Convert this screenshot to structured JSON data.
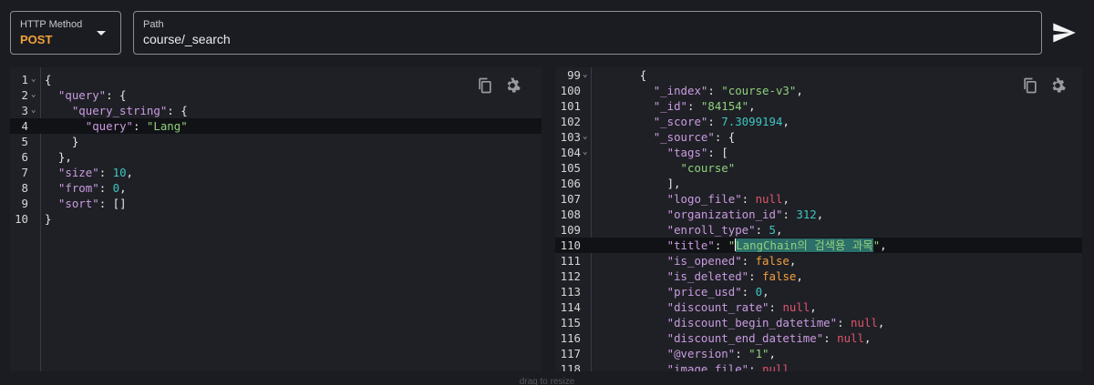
{
  "request": {
    "method_label": "HTTP Method",
    "method_value": "POST",
    "path_label": "Path",
    "path_value": "course/_search"
  },
  "query_editor": {
    "lines": [
      {
        "n": "1",
        "fold": true,
        "tokens": [
          [
            "p",
            "{"
          ]
        ]
      },
      {
        "n": "2",
        "fold": true,
        "tokens": [
          [
            "p",
            "  "
          ],
          [
            "k",
            "\"query\""
          ],
          [
            "p",
            ": {"
          ]
        ]
      },
      {
        "n": "3",
        "fold": true,
        "tokens": [
          [
            "p",
            "    "
          ],
          [
            "k",
            "\"query_string\""
          ],
          [
            "p",
            ": {"
          ]
        ]
      },
      {
        "n": "4",
        "fold": false,
        "active": true,
        "tokens": [
          [
            "p",
            "      "
          ],
          [
            "k",
            "\"query\""
          ],
          [
            "p",
            ": "
          ],
          [
            "s",
            "\"Lang\""
          ]
        ]
      },
      {
        "n": "5",
        "fold": false,
        "tokens": [
          [
            "p",
            "    }"
          ]
        ]
      },
      {
        "n": "6",
        "fold": false,
        "tokens": [
          [
            "p",
            "  },"
          ]
        ]
      },
      {
        "n": "7",
        "fold": false,
        "tokens": [
          [
            "p",
            "  "
          ],
          [
            "k",
            "\"size\""
          ],
          [
            "p",
            ": "
          ],
          [
            "n",
            "10"
          ],
          [
            "p",
            ","
          ]
        ]
      },
      {
        "n": "8",
        "fold": false,
        "tokens": [
          [
            "p",
            "  "
          ],
          [
            "k",
            "\"from\""
          ],
          [
            "p",
            ": "
          ],
          [
            "n",
            "0"
          ],
          [
            "p",
            ","
          ]
        ]
      },
      {
        "n": "9",
        "fold": false,
        "tokens": [
          [
            "p",
            "  "
          ],
          [
            "k",
            "\"sort\""
          ],
          [
            "p",
            ": []"
          ]
        ]
      },
      {
        "n": "10",
        "fold": false,
        "tokens": [
          [
            "p",
            "}"
          ]
        ]
      }
    ]
  },
  "response_viewer": {
    "lines": [
      {
        "n": "99",
        "fold": true,
        "tokens": [
          [
            "p",
            "      {"
          ]
        ]
      },
      {
        "n": "100",
        "fold": false,
        "tokens": [
          [
            "p",
            "        "
          ],
          [
            "k",
            "\"_index\""
          ],
          [
            "p",
            ": "
          ],
          [
            "s",
            "\"course-v3\""
          ],
          [
            "p",
            ","
          ]
        ]
      },
      {
        "n": "101",
        "fold": false,
        "tokens": [
          [
            "p",
            "        "
          ],
          [
            "k",
            "\"_id\""
          ],
          [
            "p",
            ": "
          ],
          [
            "s",
            "\"84154\""
          ],
          [
            "p",
            ","
          ]
        ]
      },
      {
        "n": "102",
        "fold": false,
        "tokens": [
          [
            "p",
            "        "
          ],
          [
            "k",
            "\"_score\""
          ],
          [
            "p",
            ": "
          ],
          [
            "n",
            "7.3099194"
          ],
          [
            "p",
            ","
          ]
        ]
      },
      {
        "n": "103",
        "fold": true,
        "tokens": [
          [
            "p",
            "        "
          ],
          [
            "k",
            "\"_source\""
          ],
          [
            "p",
            ": {"
          ]
        ]
      },
      {
        "n": "104",
        "fold": true,
        "tokens": [
          [
            "p",
            "          "
          ],
          [
            "k",
            "\"tags\""
          ],
          [
            "p",
            ": ["
          ]
        ]
      },
      {
        "n": "105",
        "fold": false,
        "tokens": [
          [
            "p",
            "            "
          ],
          [
            "s",
            "\"course\""
          ]
        ]
      },
      {
        "n": "106",
        "fold": false,
        "tokens": [
          [
            "p",
            "          ],"
          ]
        ]
      },
      {
        "n": "107",
        "fold": false,
        "tokens": [
          [
            "p",
            "          "
          ],
          [
            "k",
            "\"logo_file\""
          ],
          [
            "p",
            ": "
          ],
          [
            "x",
            "null"
          ],
          [
            "p",
            ","
          ]
        ]
      },
      {
        "n": "108",
        "fold": false,
        "tokens": [
          [
            "p",
            "          "
          ],
          [
            "k",
            "\"organization_id\""
          ],
          [
            "p",
            ": "
          ],
          [
            "n",
            "312"
          ],
          [
            "p",
            ","
          ]
        ]
      },
      {
        "n": "109",
        "fold": false,
        "tokens": [
          [
            "p",
            "          "
          ],
          [
            "k",
            "\"enroll_type\""
          ],
          [
            "p",
            ": "
          ],
          [
            "n",
            "5"
          ],
          [
            "p",
            ","
          ]
        ]
      },
      {
        "n": "110",
        "fold": false,
        "active": true,
        "tokens": [
          [
            "p",
            "          "
          ],
          [
            "k",
            "\"title\""
          ],
          [
            "p",
            ": "
          ],
          [
            "s",
            "\""
          ],
          [
            "c",
            ""
          ],
          [
            "h",
            "LangChain의 검색용 과목"
          ],
          [
            "s",
            "\""
          ],
          [
            "p",
            ","
          ]
        ]
      },
      {
        "n": "111",
        "fold": false,
        "tokens": [
          [
            "p",
            "          "
          ],
          [
            "k",
            "\"is_opened\""
          ],
          [
            "p",
            ": "
          ],
          [
            "b",
            "false"
          ],
          [
            "p",
            ","
          ]
        ]
      },
      {
        "n": "112",
        "fold": false,
        "tokens": [
          [
            "p",
            "          "
          ],
          [
            "k",
            "\"is_deleted\""
          ],
          [
            "p",
            ": "
          ],
          [
            "b",
            "false"
          ],
          [
            "p",
            ","
          ]
        ]
      },
      {
        "n": "113",
        "fold": false,
        "tokens": [
          [
            "p",
            "          "
          ],
          [
            "k",
            "\"price_usd\""
          ],
          [
            "p",
            ": "
          ],
          [
            "n",
            "0"
          ],
          [
            "p",
            ","
          ]
        ]
      },
      {
        "n": "114",
        "fold": false,
        "tokens": [
          [
            "p",
            "          "
          ],
          [
            "k",
            "\"discount_rate\""
          ],
          [
            "p",
            ": "
          ],
          [
            "x",
            "null"
          ],
          [
            "p",
            ","
          ]
        ]
      },
      {
        "n": "115",
        "fold": false,
        "tokens": [
          [
            "p",
            "          "
          ],
          [
            "k",
            "\"discount_begin_datetime\""
          ],
          [
            "p",
            ": "
          ],
          [
            "x",
            "null"
          ],
          [
            "p",
            ","
          ]
        ]
      },
      {
        "n": "116",
        "fold": false,
        "tokens": [
          [
            "p",
            "          "
          ],
          [
            "k",
            "\"discount_end_datetime\""
          ],
          [
            "p",
            ": "
          ],
          [
            "x",
            "null"
          ],
          [
            "p",
            ","
          ]
        ]
      },
      {
        "n": "117",
        "fold": false,
        "tokens": [
          [
            "p",
            "          "
          ],
          [
            "k",
            "\"@version\""
          ],
          [
            "p",
            ": "
          ],
          [
            "s",
            "\"1\""
          ],
          [
            "p",
            ","
          ]
        ]
      },
      {
        "n": "118",
        "fold": false,
        "tokens": [
          [
            "p",
            "          "
          ],
          [
            "k",
            "\"image_file\""
          ],
          [
            "p",
            ": "
          ],
          [
            "x",
            "null"
          ]
        ]
      }
    ]
  },
  "icons": {
    "copy": "copy-icon",
    "settings": "gear-icon",
    "send": "send-icon",
    "dropdown": "chevron-down-icon"
  },
  "footer": {
    "resize_hint": "drag to resize"
  }
}
